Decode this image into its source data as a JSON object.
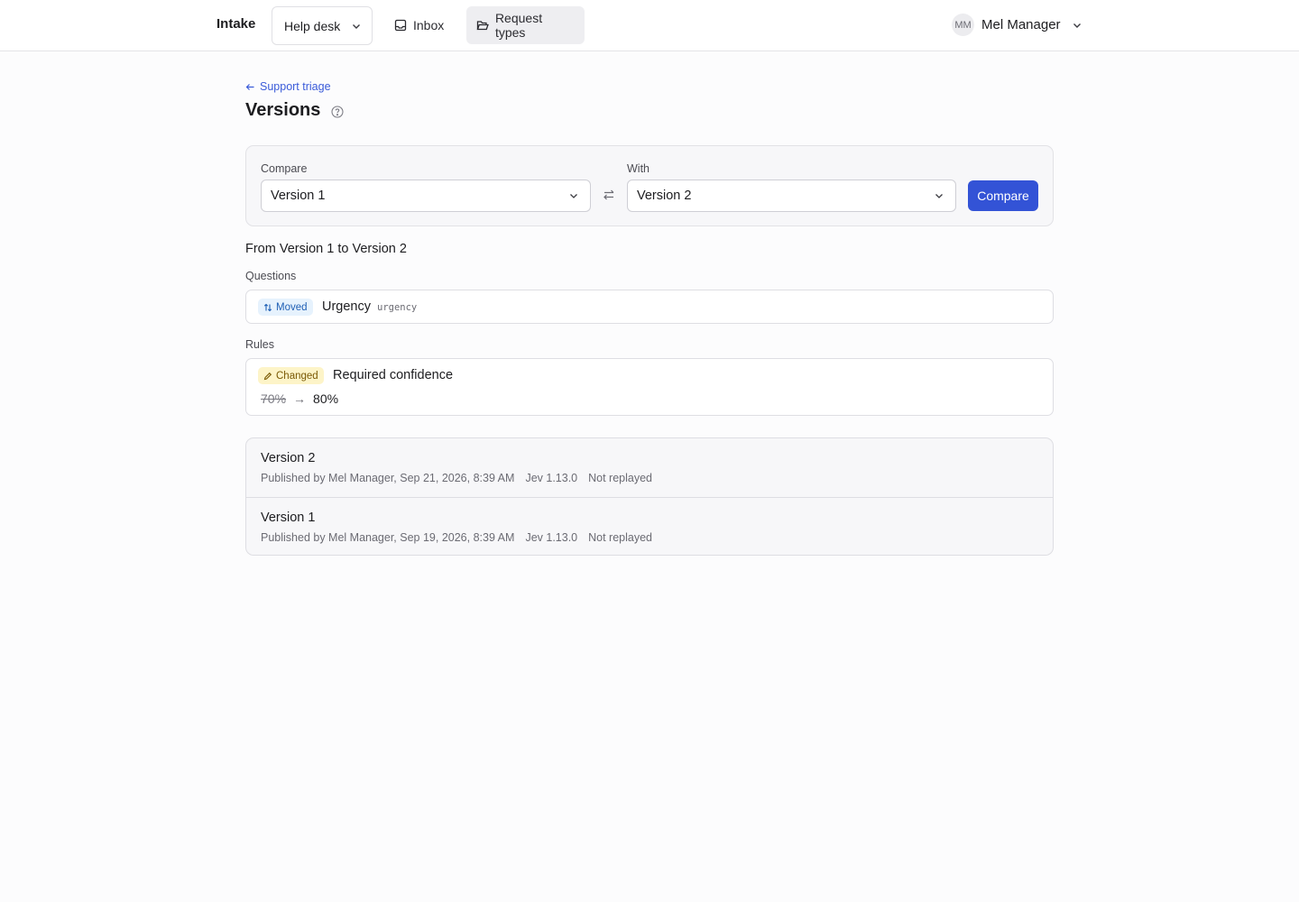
{
  "nav": {
    "brand": "Intake",
    "workspace": "Help desk",
    "inbox": "Inbox",
    "request_types": "Request types",
    "user_initials": "MM",
    "user_name": "Mel Manager"
  },
  "page": {
    "back_label": "Support triage",
    "title": "Versions"
  },
  "compare": {
    "compare_label": "Compare",
    "compare_value": "Version 1",
    "with_label": "With",
    "with_value": "Version 2",
    "button": "Compare"
  },
  "diff": {
    "title": "From Version 1 to Version 2",
    "questions_label": "Questions",
    "questions": [
      {
        "badge": "Moved",
        "label": "Urgency",
        "key": "urgency"
      }
    ],
    "rules_label": "Rules",
    "rules": [
      {
        "badge": "Changed",
        "label": "Required confidence",
        "old": "70%",
        "arrow": "→",
        "new": "80%"
      }
    ]
  },
  "versions": [
    {
      "title": "Version 2",
      "published": "Published by Mel Manager, Sep 21, 2026, 8:39 AM",
      "engine": "Jev 1.13.0",
      "status": "Not replayed"
    },
    {
      "title": "Version 1",
      "published": "Published by Mel Manager, Sep 19, 2026, 8:39 AM",
      "engine": "Jev 1.13.0",
      "status": "Not replayed"
    }
  ],
  "colors": {
    "accent": "#3353d6",
    "moved_badge_bg": "#e6f2fd",
    "changed_badge_bg": "#fdf4c8"
  }
}
